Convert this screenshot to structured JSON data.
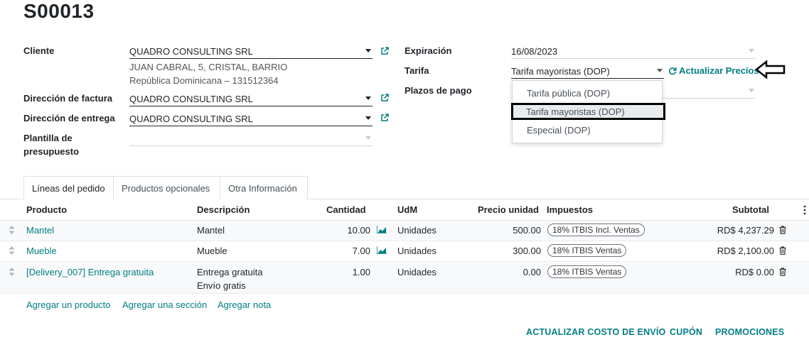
{
  "record_title": "S00013",
  "left_form": {
    "cliente_label": "Cliente",
    "cliente_value": "QUADRO CONSULTING SRL",
    "cliente_addr1": "JUAN CABRAL, 5, CRISTAL, BARRIO",
    "cliente_addr2": "República Dominicana – 131512364",
    "factura_label": "Dirección de factura",
    "factura_value": "QUADRO CONSULTING SRL",
    "entrega_label": "Dirección de entrega",
    "entrega_value": "QUADRO CONSULTING SRL",
    "plantilla_label_1": "Plantilla de",
    "plantilla_label_2": "presupuesto",
    "plantilla_value": ""
  },
  "right_form": {
    "expiracion_label": "Expiración",
    "expiracion_value": "16/08/2023",
    "tarifa_label": "Tarifa",
    "tarifa_value": "Tarifa mayoristas (DOP)",
    "actualizar_precios": "Actualizar Precios",
    "plazos_label": "Plazos de pago",
    "plazos_value": ""
  },
  "tarifa_dropdown": {
    "options": [
      "Tarifa pública (DOP)",
      "Tarifa mayoristas (DOP)",
      "Especial (DOP)"
    ],
    "highlighted_index": 1
  },
  "tabs": [
    {
      "label": "Líneas del pedido",
      "active": true
    },
    {
      "label": "Productos opcionales",
      "active": false
    },
    {
      "label": "Otra Información",
      "active": false
    }
  ],
  "table": {
    "headers": {
      "producto": "Producto",
      "descripcion": "Descripción",
      "cantidad": "Cantidad",
      "udm": "UdM",
      "precio": "Precio unidad",
      "impuestos": "Impuestos",
      "subtotal": "Subtotal"
    },
    "rows": [
      {
        "producto": "Mantel",
        "descripcion": "Mantel",
        "descripcion2": "",
        "cantidad": "10.00",
        "udm": "Unidades",
        "precio": "500.00",
        "impuesto": "18% ITBIS Incl. Ventas",
        "subtotal": "RD$ 4,237.29"
      },
      {
        "producto": "Mueble",
        "descripcion": "Mueble",
        "descripcion2": "",
        "cantidad": "7.00",
        "udm": "Unidades",
        "precio": "300.00",
        "impuesto": "18% ITBIS Ventas",
        "subtotal": "RD$ 2,100.00"
      },
      {
        "producto": "[Delivery_007] Entrega gratuita",
        "descripcion": "Entrega gratuita",
        "descripcion2": "Envío gratis",
        "cantidad": "1.00",
        "udm": "Unidades",
        "precio": "0.00",
        "impuesto": "18% ITBIS Ventas",
        "subtotal": "RD$ 0.00"
      }
    ]
  },
  "add_links": {
    "producto": "Agregar un producto",
    "seccion": "Agregar una sección",
    "nota": "Agregar nota"
  },
  "footer_buttons": {
    "envio": "ACTUALIZAR COSTO DE ENVÍO",
    "cupon": "CUPÓN",
    "promociones": "PROMOCIONES"
  },
  "colors": {
    "accent": "#017e84"
  }
}
